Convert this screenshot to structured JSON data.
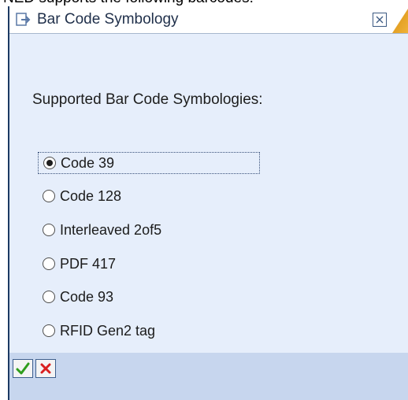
{
  "page": {
    "top_text": "NED supports the following barcodes:"
  },
  "dialog": {
    "title": "Bar Code Symbology",
    "heading": "Supported Bar Code Symbologies:",
    "options": [
      {
        "label": "Code 39",
        "selected": true
      },
      {
        "label": "Code 128",
        "selected": false
      },
      {
        "label": "Interleaved 2of5",
        "selected": false
      },
      {
        "label": "PDF 417",
        "selected": false
      },
      {
        "label": "Code 93",
        "selected": false
      },
      {
        "label": "RFID Gen2 tag",
        "selected": false
      }
    ],
    "buttons": {
      "ok_icon": "green-check-icon",
      "cancel_icon": "red-x-icon"
    }
  },
  "colors": {
    "title_accent": "#f1b43c",
    "dialog_background": "#e6eefb",
    "footer_background": "#c7d6ee",
    "ok_check": "#2f9d1c",
    "cancel_x": "#d91f1f"
  }
}
